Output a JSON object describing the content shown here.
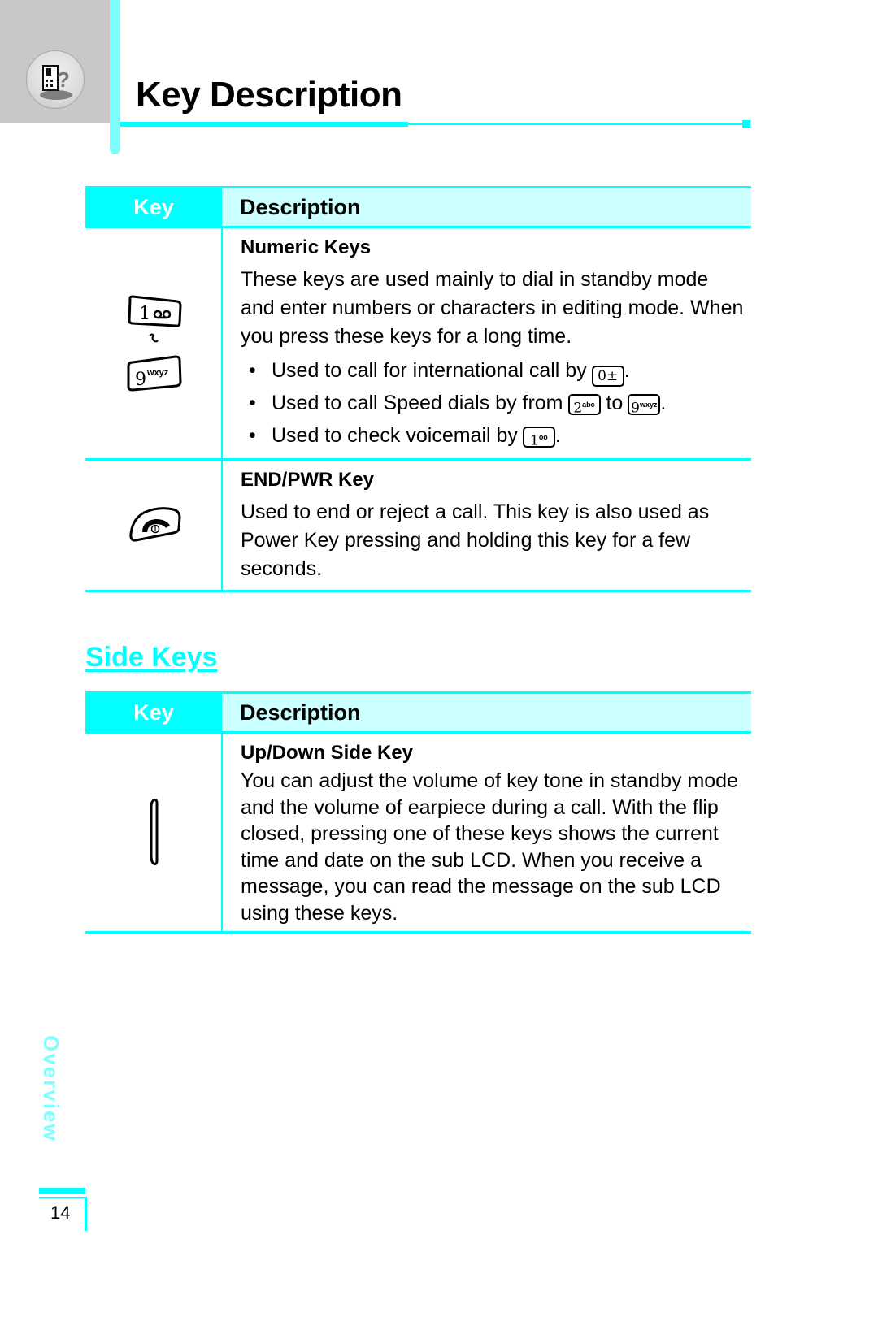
{
  "header": {
    "chapter_icon": "phone-help-icon",
    "title": "Key Description"
  },
  "tables": [
    {
      "header": {
        "key": "Key",
        "description": "Description"
      },
      "rows": [
        {
          "key_icons": [
            "key-1-voicemail-icon",
            "tilde-range-icon",
            "key-9-wxyz-icon"
          ],
          "title": "Numeric Keys",
          "paragraph": "These keys are used mainly to dial in standby mode and enter numbers or characters in editing mode. When you press these keys for a long time.",
          "bullets": [
            {
              "text": "Used to call for international call by",
              "keys": [
                "0±"
              ],
              "suffix": "."
            },
            {
              "text": "Used to call Speed dials by from",
              "keys": [
                "2abc",
                "9wxyz"
              ],
              "joiner": "to",
              "suffix": "."
            },
            {
              "text": "Used to check voicemail by",
              "keys": [
                "1oo"
              ],
              "suffix": "."
            }
          ]
        },
        {
          "key_icons": [
            "end-power-key-icon"
          ],
          "title": "END/PWR Key",
          "paragraph": "Used to end or reject a call. This key is also used as Power Key pressing and holding this key for a few seconds."
        }
      ]
    },
    {
      "header": {
        "key": "Key",
        "description": "Description"
      },
      "rows": [
        {
          "key_icons": [
            "side-key-icon"
          ],
          "title": "Up/Down Side Key",
          "paragraph": "You can adjust the volume of key tone in standby mode and the volume of earpiece during a call. With the flip closed, pressing one of these keys shows the current time and date on the sub LCD. When you receive a message, you can read the message on the sub LCD using these keys."
        }
      ]
    }
  ],
  "section": {
    "title": "Side Keys"
  },
  "side_tab": {
    "label": "Overview"
  },
  "footer": {
    "page_number": "14"
  },
  "colors": {
    "accent": "#00ffff",
    "header_light": "#ccffff",
    "side_tab": "#80ffff",
    "gray_block": "#c8c8c8"
  },
  "key_labels": {
    "k0": "0",
    "k0_sub": "±",
    "k1": "1",
    "k1_sub": "oo",
    "k2": "2",
    "k2_sub": "abc",
    "k9": "9",
    "k9_sub": "wxyz",
    "to": "to",
    "dot": "."
  }
}
